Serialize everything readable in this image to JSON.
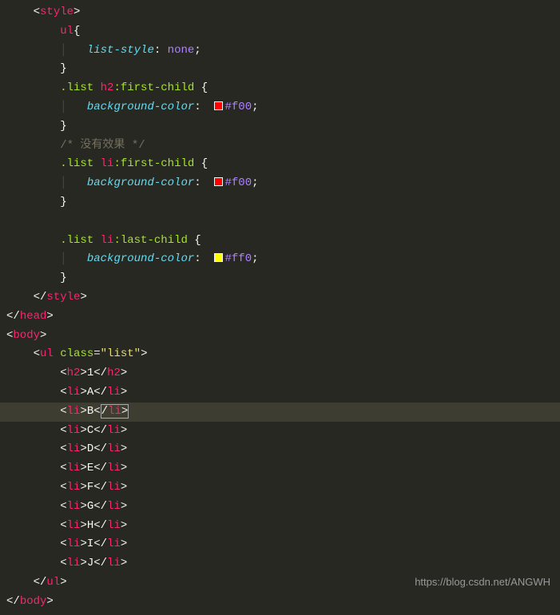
{
  "code": {
    "rules": [
      {
        "selector": "ul",
        "prop": "list-style",
        "value": "none"
      },
      {
        "selector": ".list h2:first-child",
        "prop": "background-color",
        "value": "#f00",
        "swatch": "#ff0000"
      },
      {
        "comment": "/* 没有效果 */"
      },
      {
        "selector": ".list li:first-child",
        "prop": "background-color",
        "value": "#f00",
        "swatch": "#ff0000"
      },
      {
        "selector": ".list li:last-child",
        "prop": "background-color",
        "value": "#ff0",
        "swatch": "#ffff00"
      }
    ],
    "tags": {
      "style_open": "style",
      "style_close": "style",
      "head_close": "head",
      "body_open": "body",
      "body_close": "body",
      "ul": "ul",
      "h2": "h2",
      "li": "li"
    },
    "ul_attr": {
      "name": "class",
      "value": "\"list\""
    },
    "h2_text": "1",
    "list_items": [
      "A",
      "B",
      "C",
      "D",
      "E",
      "F",
      "G",
      "H",
      "I",
      "J"
    ],
    "highlight_index": 1
  },
  "watermark": "https://blog.csdn.net/ANGWH"
}
